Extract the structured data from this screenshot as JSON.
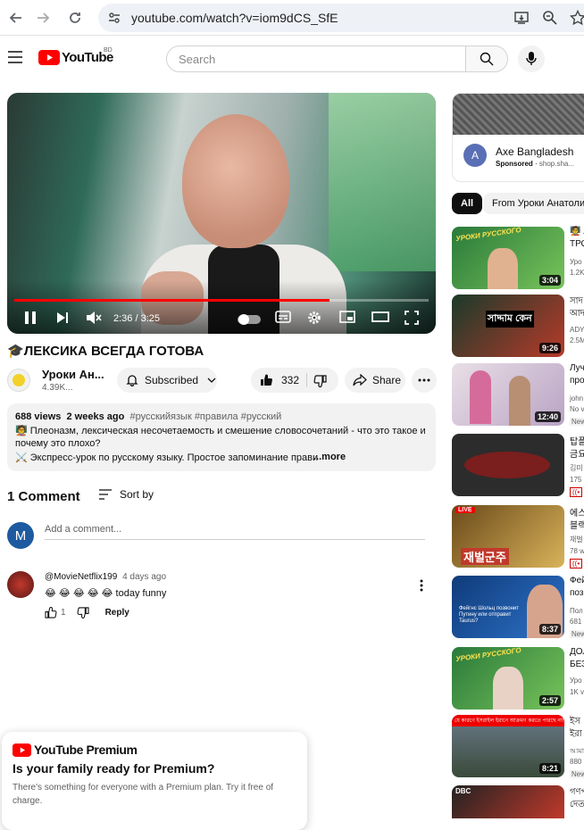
{
  "browser": {
    "url": "youtube.com/watch?v=iom9dCS_SfE"
  },
  "header": {
    "logo_text": "YouTube",
    "country_code": "BD",
    "search_placeholder": "Search"
  },
  "player": {
    "time_current": "2:36",
    "time_sep": " / ",
    "time_total": "3:25",
    "progress": 0.76
  },
  "video": {
    "title_emoji": "🎓",
    "title": "ЛЕКСИКА ВСЕГДА ГОТОВА",
    "channel_name": "Уроки Ан...",
    "channel_subs": "4.39K...",
    "subscribe_label": "Subscribed",
    "like_count": "332",
    "share_label": "Share",
    "views": "688 views",
    "age": "2 weeks ago",
    "hashtags": "#русскийязык #правила #русский",
    "desc_line1": "🧑‍🏫 Плеоназм, лексическая несочетаемость и смешение словосочетаний - что это такое и",
    "desc_line2": "почему это плохо?",
    "desc_line3": "⚔️ Экспресс-урок по русскому языку. Простое запоминание прави",
    "more_label": "...more"
  },
  "comments": {
    "count_label": "1 Comment",
    "sort_label": "Sort by",
    "my_avatar_letter": "M",
    "add_placeholder": "Add a comment...",
    "items": [
      {
        "user": "@MovieNetflix199",
        "age": "4 days ago",
        "text": "😂 😂 😂 😂 😂 today funny",
        "likes": "1",
        "reply_label": "Reply"
      }
    ]
  },
  "premium_popup": {
    "logo": "YouTube Premium",
    "heading": "Is your family ready for Premium?",
    "body_line1": "There's something for everyone with a Premium plan. Try it free of",
    "body_line2": "charge."
  },
  "sidebar": {
    "ad": {
      "avatar_letter": "A",
      "name": "Axe Bangladesh",
      "sponsored": "Sponsored",
      "domain": "shop.sha..."
    },
    "chips": [
      "All",
      "From Уроки Анатолия"
    ],
    "videos": [
      {
        "duration": "3:04",
        "title1": "🧑‍🏫 Л",
        "title2": "ТРО",
        "meta": "Уро",
        "meta2": "1.2K"
      },
      {
        "duration": "9:26",
        "title1": "সাদ",
        "title2": "আদ",
        "meta": "ADY",
        "meta2": "2.5M"
      },
      {
        "duration": "12:40",
        "title1": "Луч",
        "title2": "про",
        "meta": "john",
        "meta2": "No v",
        "badge": "New"
      },
      {
        "duration": "",
        "title1": "탑플",
        "title2": "금요",
        "meta": "김미",
        "meta2": "175",
        "live": true
      },
      {
        "duration": "",
        "title1": "에스",
        "title2": "블랙",
        "meta": "재벌",
        "meta2": "78 w",
        "live": true
      },
      {
        "duration": "8:37",
        "title1": "Фей",
        "title2": "поз",
        "meta": "Пол",
        "meta2": "681",
        "badge": "New"
      },
      {
        "duration": "2:57",
        "title1": "ДОЛ",
        "title2": "БЕЗ",
        "meta": "Уро",
        "meta2": "1K v"
      },
      {
        "duration": "8:21",
        "title1": "ইস",
        "title2": "ইরা",
        "meta": "আমা",
        "meta2": "880",
        "badge": "New"
      },
      {
        "duration": "",
        "title1": "গণপ",
        "title2": "দেত",
        "meta": "",
        "meta2": ""
      }
    ],
    "thumb_texts": {
      "t1": "УРОКИ РУССКОГО",
      "t2": "সাদ্দাম কেন",
      "t5a": "LIVE",
      "t5b": "재벌군주",
      "t6": "Фейгнс Шольц позвонит Путину или отправит Taurus?",
      "t7": "УРОКИ РУССКОГО",
      "t8": "যে কারণে ইসরাইল ইরানে আক্রমণ করতে পারছে না!",
      "t9": "DBC"
    }
  },
  "colors": {
    "red": "#ff0000",
    "chip_active_bg": "#0f0f0f",
    "chip_bg": "#f2f2f2",
    "link": "#065fd4"
  }
}
